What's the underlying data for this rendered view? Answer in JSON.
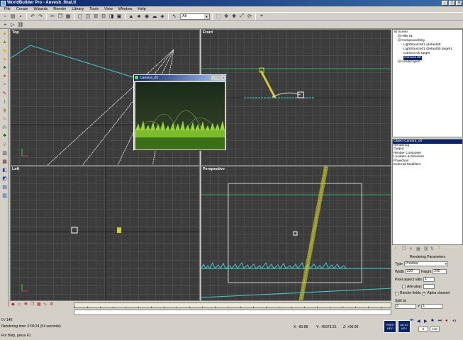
{
  "window": {
    "title": "WorldBuilder Pro - Anvesh_final.tl",
    "minimize": "_",
    "maximize": "□",
    "close": "×"
  },
  "menu": [
    "File",
    "Create",
    "Wizards",
    "Render",
    "Library",
    "Tools",
    "View",
    "Window",
    "Help"
  ],
  "toolbar": {
    "filter_value": "All"
  },
  "viewports": {
    "top": "Top",
    "front": "Front",
    "left": "Left",
    "perspective": "Perspective"
  },
  "camera_window": {
    "title": "Camera_01"
  },
  "scene_tree": {
    "items": [
      {
        "label": "Scene",
        "indent": 0
      },
      {
        "label": "Hills 01",
        "indent": 1
      },
      {
        "label": "Compound\\Sky",
        "indent": 1
      },
      {
        "label": "LightSource01 (default)0",
        "indent": 2
      },
      {
        "label": "LightSource01 (default)0.target1",
        "indent": 2
      },
      {
        "label": "Camera 00 target",
        "indent": 2
      },
      {
        "label": "Camera 00",
        "indent": 2,
        "selected": true
      },
      {
        "label": "Landscape0",
        "indent": 1
      }
    ]
  },
  "object_props": {
    "items": [
      {
        "label": "Object Camera_00",
        "selected": true
      },
      {
        "label": "Rendering"
      },
      {
        "label": "Output"
      },
      {
        "label": "Render Composer"
      },
      {
        "label": "Location & Direction"
      },
      {
        "label": "Projection"
      },
      {
        "label": "External Modifiers"
      }
    ]
  },
  "render_params": {
    "title": "Rendering Parameters",
    "type_label": "Type",
    "type_value": "Preview",
    "width_label": "Width",
    "width_value": "320",
    "height_label": "Height",
    "height_value": "240",
    "aspect_label": "Pixel aspect ratio",
    "aspect_value": "1",
    "antialias_label": "Anti-alias",
    "render_fields_label": "Render fields",
    "alpha_label": "Alpha channel",
    "split_label": "Split by",
    "split_x": "2",
    "split_y_label": "Y",
    "split_y": "1"
  },
  "timeline": {
    "frame_readout": "0 / 140"
  },
  "status": {
    "render_time": "Rendering time: 0:00:24 (54 seconds)",
    "help": "For Help, press F1",
    "x": "X: -60.88",
    "y": "Y: -45973.26",
    "z": "Z: +00.00",
    "preview_btn": "PREV KEY",
    "auto_btn": "AUTO KEY",
    "frame_a": "0",
    "frame_b": "140"
  }
}
